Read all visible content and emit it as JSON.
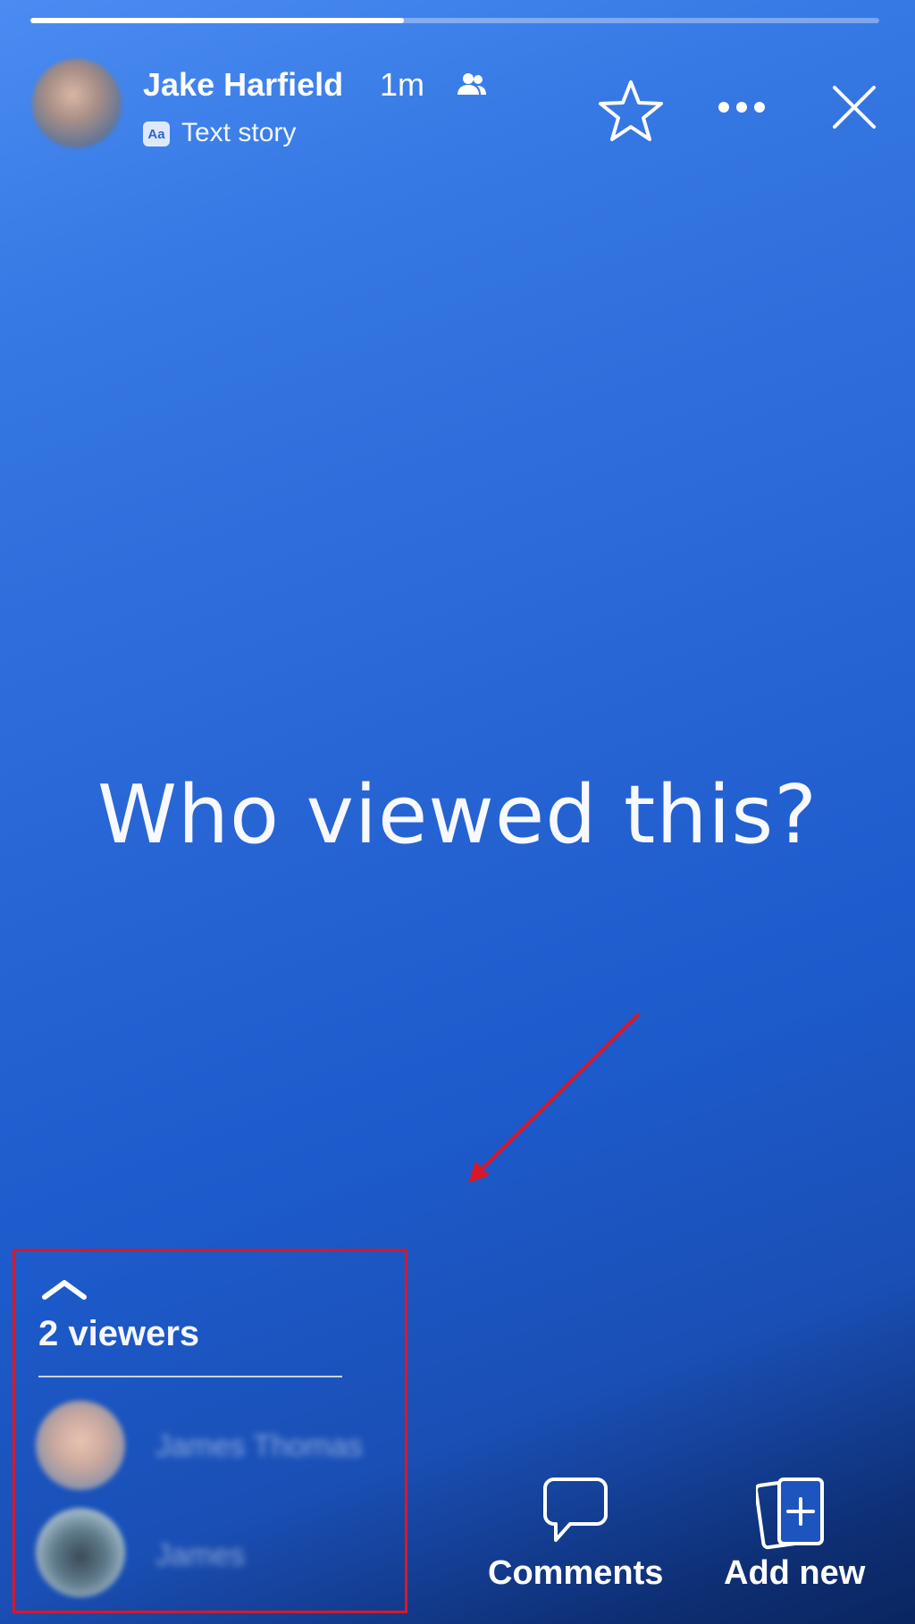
{
  "story": {
    "progress": 0.44,
    "author_name": "Jake Harfield",
    "time_ago": "1m",
    "audience_icon": "friends-icon",
    "story_type_badge": "Aa",
    "story_type_label": "Text story",
    "text": "Who viewed this?"
  },
  "header_actions": {
    "favorite_icon": "star-icon",
    "more_icon": "more-options-icon",
    "close_icon": "close-icon"
  },
  "viewers": {
    "expand_icon": "chevron-up-icon",
    "count_label": "2 viewers",
    "list": [
      {
        "name": "James Thomas"
      },
      {
        "name": "James"
      }
    ]
  },
  "bottom_actions": {
    "comments_label": "Comments",
    "add_new_label": "Add new"
  },
  "colors": {
    "background_top": "#4a8cf2",
    "background_bottom": "#0a2560",
    "annotation": "#d8182a"
  }
}
